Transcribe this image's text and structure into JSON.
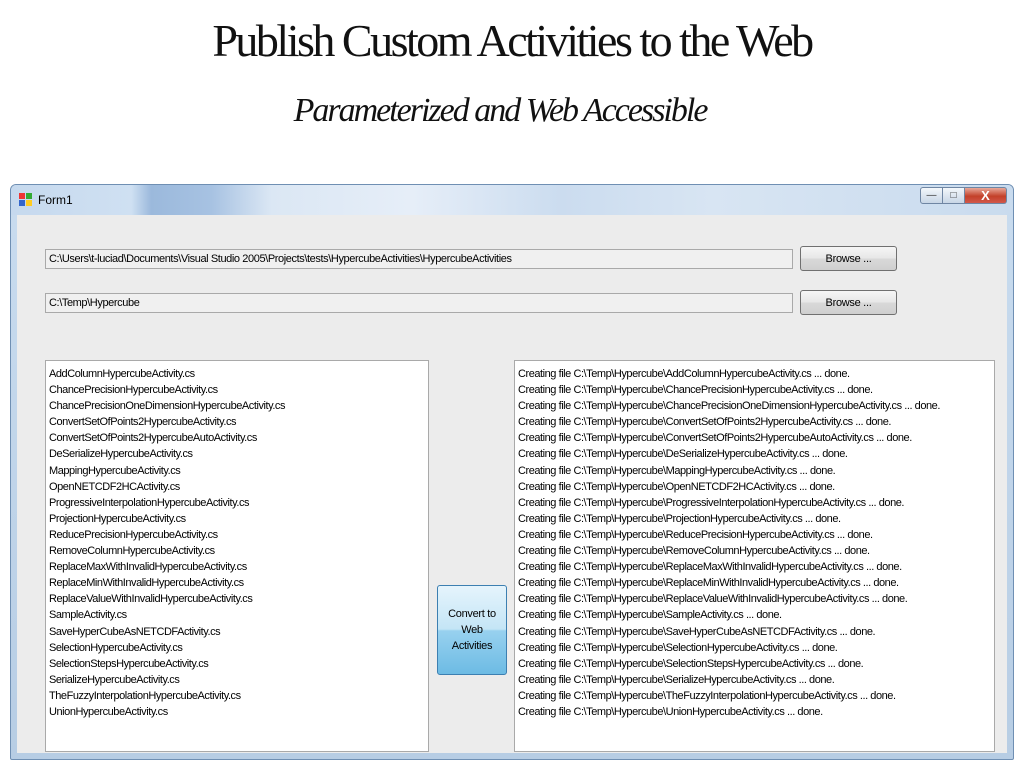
{
  "slide": {
    "title": "Publish Custom Activities to the Web",
    "subtitle": "Parameterized and Web Accessible"
  },
  "window": {
    "title": "Form1",
    "icon": "windows-form-icon",
    "controls": {
      "minimize": "—",
      "maximize": "□",
      "close": "X"
    }
  },
  "form": {
    "source_path": "C:\\Users\\t-luciad\\Documents\\Visual Studio 2005\\Projects\\tests\\HypercubeActivities\\HypercubeActivities",
    "output_path": "C:\\Temp\\Hypercube",
    "browse_label_1": "Browse ...",
    "browse_label_2": "Browse ...",
    "convert_label": "Convert to Web Activities"
  },
  "activities": [
    "AddColumnHypercubeActivity.cs",
    "ChancePrecisionHypercubeActivity.cs",
    "ChancePrecisionOneDimensionHypercubeActivity.cs",
    "ConvertSetOfPoints2HypercubeActivity.cs",
    "ConvertSetOfPoints2HypercubeAutoActivity.cs",
    "DeSerializeHypercubeActivity.cs",
    "MappingHypercubeActivity.cs",
    "OpenNETCDF2HCActivity.cs",
    "ProgressiveInterpolationHypercubeActivity.cs",
    "ProjectionHypercubeActivity.cs",
    "ReducePrecisionHypercubeActivity.cs",
    "RemoveColumnHypercubeActivity.cs",
    "ReplaceMaxWithInvalidHypercubeActivity.cs",
    "ReplaceMinWithInvalidHypercubeActivity.cs",
    "ReplaceValueWithInvalidHypercubeActivity.cs",
    "SampleActivity.cs",
    "SaveHyperCubeAsNETCDFActivity.cs",
    "SelectionHypercubeActivity.cs",
    "SelectionStepsHypercubeActivity.cs",
    "SerializeHypercubeActivity.cs",
    "TheFuzzyInterpolationHypercubeActivity.cs",
    "UnionHypercubeActivity.cs"
  ],
  "log": [
    "Creating file C:\\Temp\\Hypercube\\AddColumnHypercubeActivity.cs ...  done.",
    "Creating file C:\\Temp\\Hypercube\\ChancePrecisionHypercubeActivity.cs ...  done.",
    "Creating file C:\\Temp\\Hypercube\\ChancePrecisionOneDimensionHypercubeActivity.cs ...  done.",
    "Creating file C:\\Temp\\Hypercube\\ConvertSetOfPoints2HypercubeActivity.cs ...  done.",
    "Creating file C:\\Temp\\Hypercube\\ConvertSetOfPoints2HypercubeAutoActivity.cs ...  done.",
    "Creating file C:\\Temp\\Hypercube\\DeSerializeHypercubeActivity.cs ...  done.",
    "Creating file C:\\Temp\\Hypercube\\MappingHypercubeActivity.cs ...  done.",
    "Creating file C:\\Temp\\Hypercube\\OpenNETCDF2HCActivity.cs ...  done.",
    "Creating file C:\\Temp\\Hypercube\\ProgressiveInterpolationHypercubeActivity.cs ...  done.",
    "Creating file C:\\Temp\\Hypercube\\ProjectionHypercubeActivity.cs ...  done.",
    "Creating file C:\\Temp\\Hypercube\\ReducePrecisionHypercubeActivity.cs ...  done.",
    "Creating file C:\\Temp\\Hypercube\\RemoveColumnHypercubeActivity.cs ...  done.",
    "Creating file C:\\Temp\\Hypercube\\ReplaceMaxWithInvalidHypercubeActivity.cs ...  done.",
    "Creating file C:\\Temp\\Hypercube\\ReplaceMinWithInvalidHypercubeActivity.cs ...  done.",
    "Creating file C:\\Temp\\Hypercube\\ReplaceValueWithInvalidHypercubeActivity.cs ...  done.",
    "Creating file C:\\Temp\\Hypercube\\SampleActivity.cs ...  done.",
    "Creating file C:\\Temp\\Hypercube\\SaveHyperCubeAsNETCDFActivity.cs ...  done.",
    "Creating file C:\\Temp\\Hypercube\\SelectionHypercubeActivity.cs ...  done.",
    "Creating file C:\\Temp\\Hypercube\\SelectionStepsHypercubeActivity.cs ...  done.",
    "Creating file C:\\Temp\\Hypercube\\SerializeHypercubeActivity.cs ...  done.",
    "Creating file C:\\Temp\\Hypercube\\TheFuzzyInterpolationHypercubeActivity.cs ...  done.",
    "Creating file C:\\Temp\\Hypercube\\UnionHypercubeActivity.cs ...  done."
  ]
}
